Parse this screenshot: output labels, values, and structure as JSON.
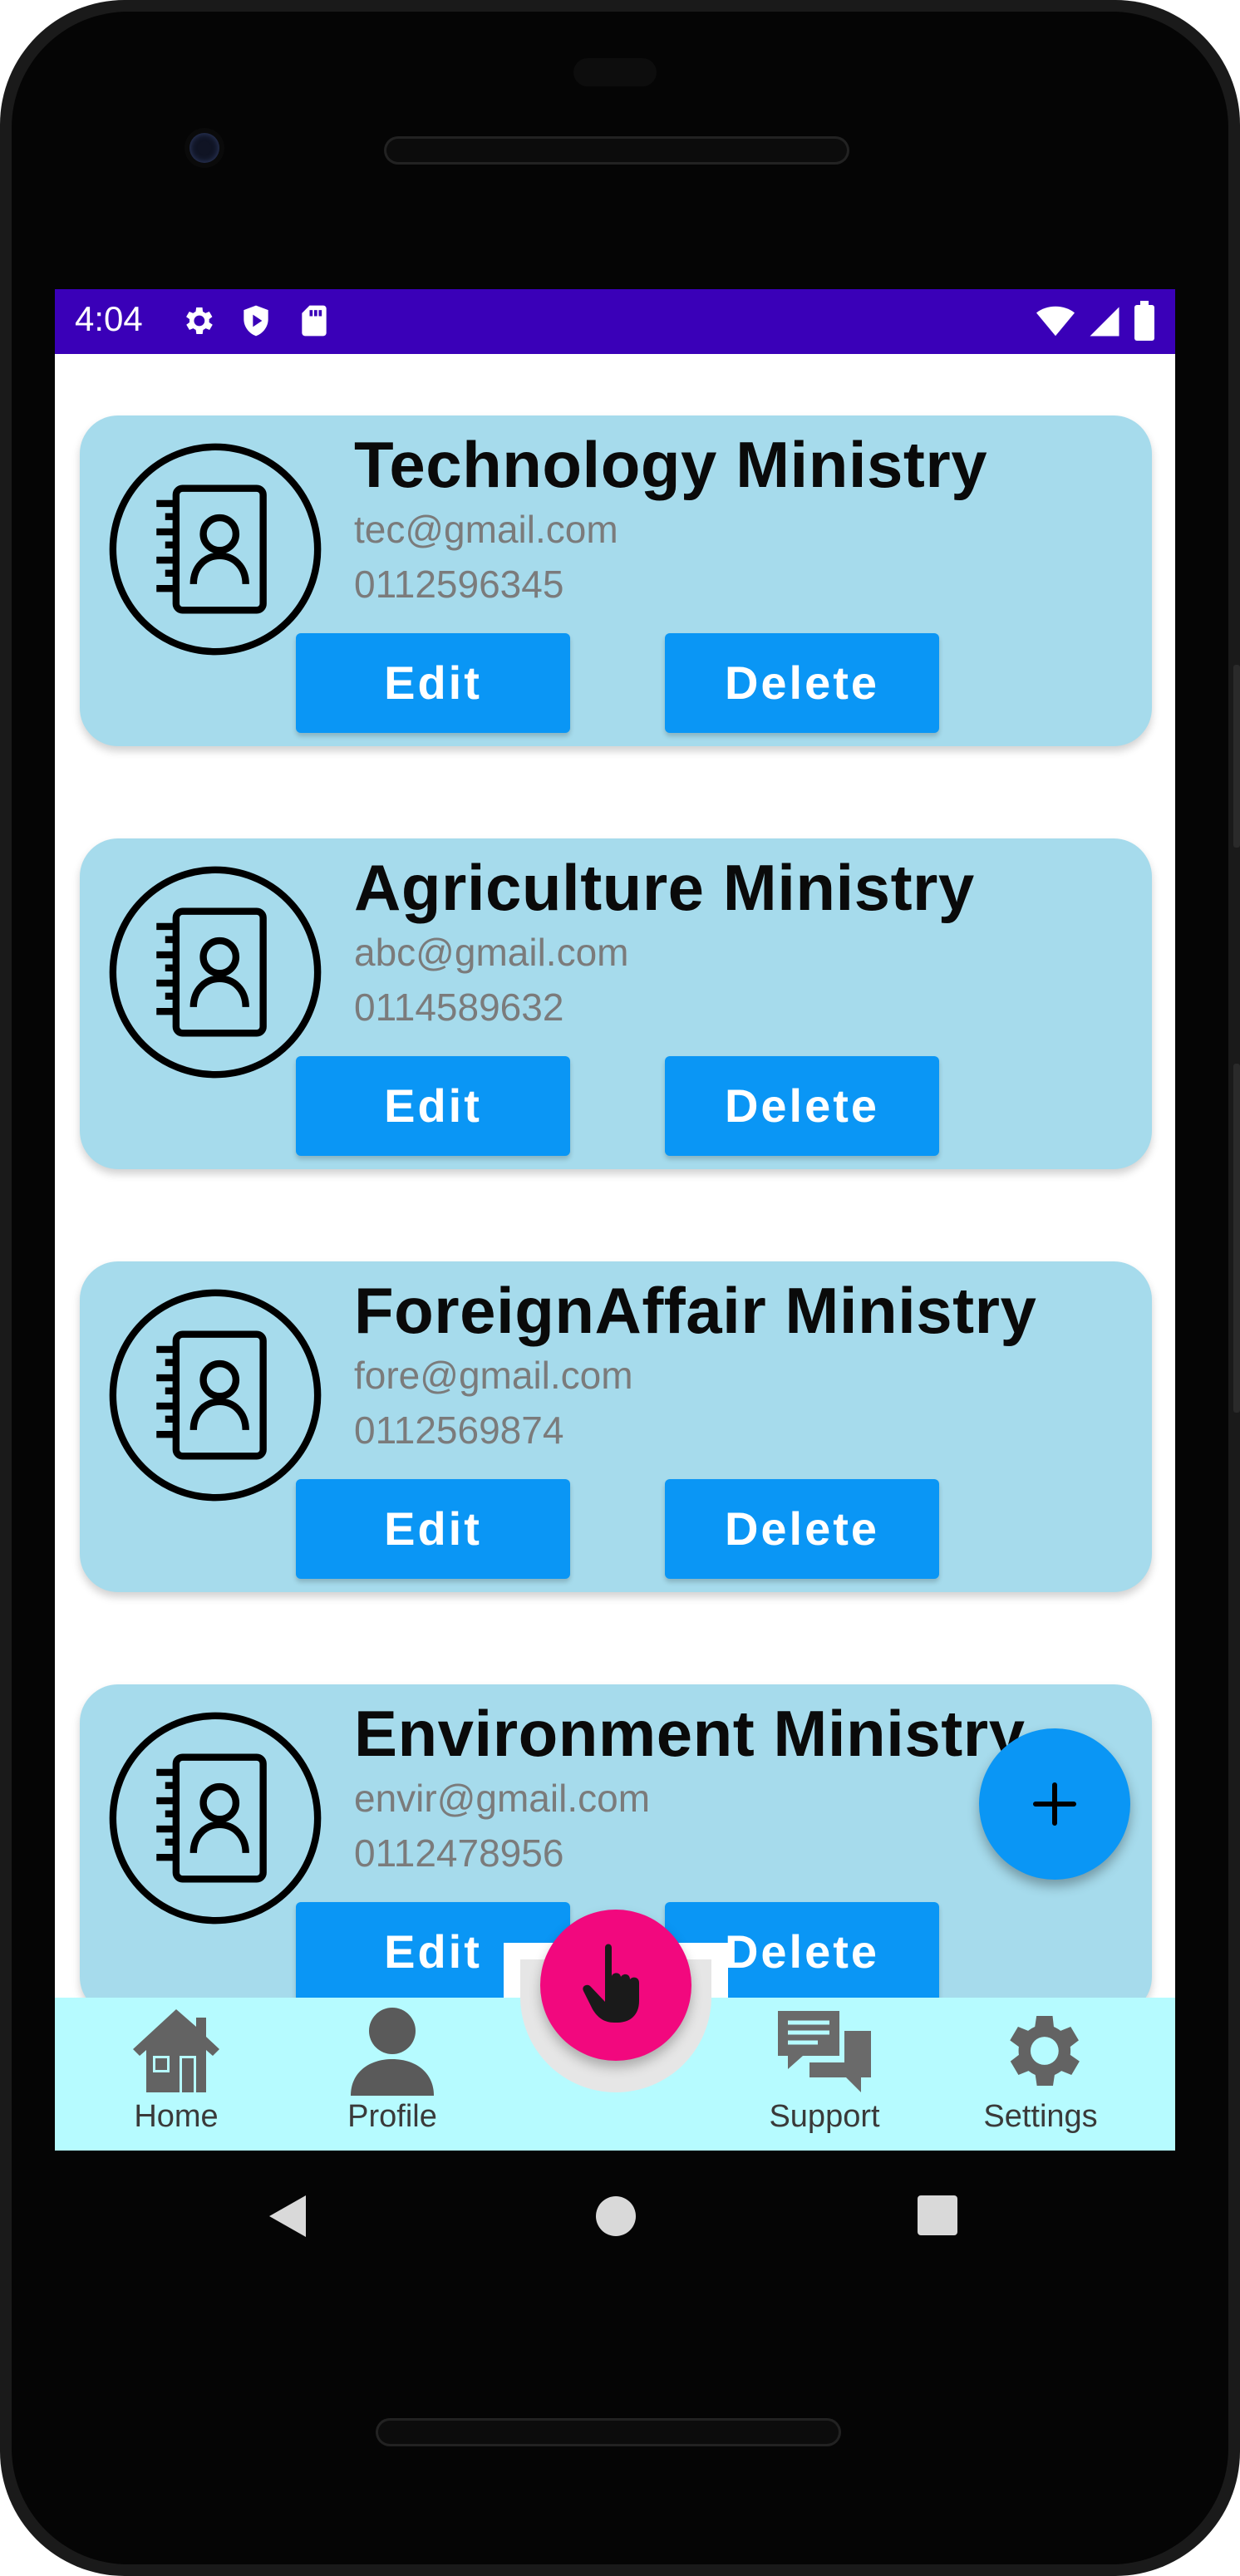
{
  "status_bar": {
    "time": "4:04",
    "left_icons": [
      "gear-icon",
      "shield-play-icon",
      "sd-card-icon"
    ],
    "right_icons": [
      "wifi-icon",
      "signal-icon",
      "battery-icon"
    ],
    "color": "#3a00b8"
  },
  "contacts": [
    {
      "name": "Technology Ministry",
      "email": "tec@gmail.com",
      "phone": "0112596345",
      "edit_label": "Edit",
      "delete_label": "Delete"
    },
    {
      "name": "Agriculture Ministry",
      "email": "abc@gmail.com",
      "phone": "0114589632",
      "edit_label": "Edit",
      "delete_label": "Delete"
    },
    {
      "name": "ForeignAffair Ministry",
      "email": "fore@gmail.com",
      "phone": "0112569874",
      "edit_label": "Edit",
      "delete_label": "Delete"
    },
    {
      "name": "Environment Ministry",
      "email": "envir@gmail.com",
      "phone": "0112478956",
      "edit_label": "Edit",
      "delete_label": "Delete"
    }
  ],
  "fab": {
    "icon": "plus-icon",
    "color": "#0a96f5"
  },
  "center_fab": {
    "icon": "hand-pointing-icon",
    "color": "#f2087e"
  },
  "bottom_nav": {
    "background": "#b6fbff",
    "items": [
      {
        "label": "Home",
        "icon": "home-icon"
      },
      {
        "label": "Profile",
        "icon": "person-icon"
      },
      {
        "label": "Support",
        "icon": "chat-icon"
      },
      {
        "label": "Settings",
        "icon": "gear-icon"
      }
    ]
  },
  "system_nav": [
    "back-icon",
    "home-circle-icon",
    "recents-square-icon"
  ],
  "colors": {
    "card": "#a6dbec",
    "button": "#0a96f5"
  }
}
